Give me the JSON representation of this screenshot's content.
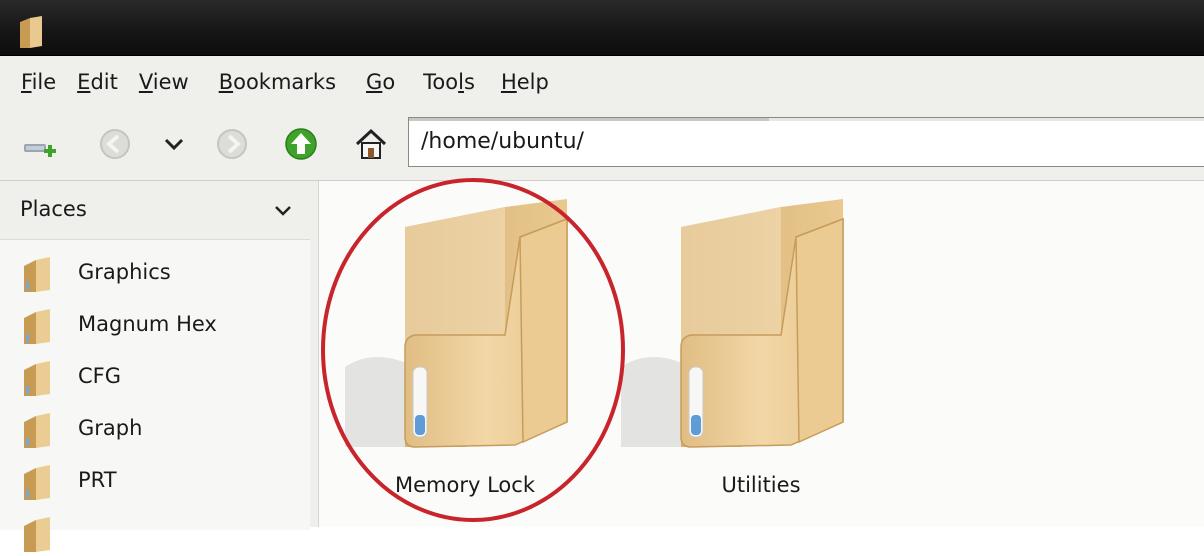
{
  "menubar": {
    "items": [
      {
        "mnemonic": "F",
        "rest": "ile"
      },
      {
        "mnemonic": "E",
        "rest": "dit"
      },
      {
        "mnemonic": "V",
        "rest": "iew"
      },
      {
        "mnemonic": "B",
        "rest": "ookmarks"
      },
      {
        "mnemonic": "G",
        "rest": "o"
      },
      {
        "pre": "Too",
        "mnemonic": "l",
        "rest": "s"
      },
      {
        "mnemonic": "H",
        "rest": "elp"
      }
    ]
  },
  "toolbar": {
    "location": "/home/ubuntu/",
    "icons": [
      "new-tab-icon",
      "back-icon",
      "history-chevron-icon",
      "forward-icon",
      "up-icon",
      "home-icon"
    ]
  },
  "sidebar": {
    "header": "Places",
    "items": [
      {
        "label": "Graphics"
      },
      {
        "label": "Magnum Hex"
      },
      {
        "label": "CFG"
      },
      {
        "label": "Graph"
      },
      {
        "label": "PRT"
      }
    ]
  },
  "main": {
    "items": [
      {
        "label": "Memory Lock",
        "selected_marked": true
      },
      {
        "label": "Utilities",
        "selected_marked": false
      }
    ]
  },
  "colors": {
    "annotation": "#c8242c",
    "folder": "#e7c48a",
    "up_green": "#3fa22a"
  }
}
